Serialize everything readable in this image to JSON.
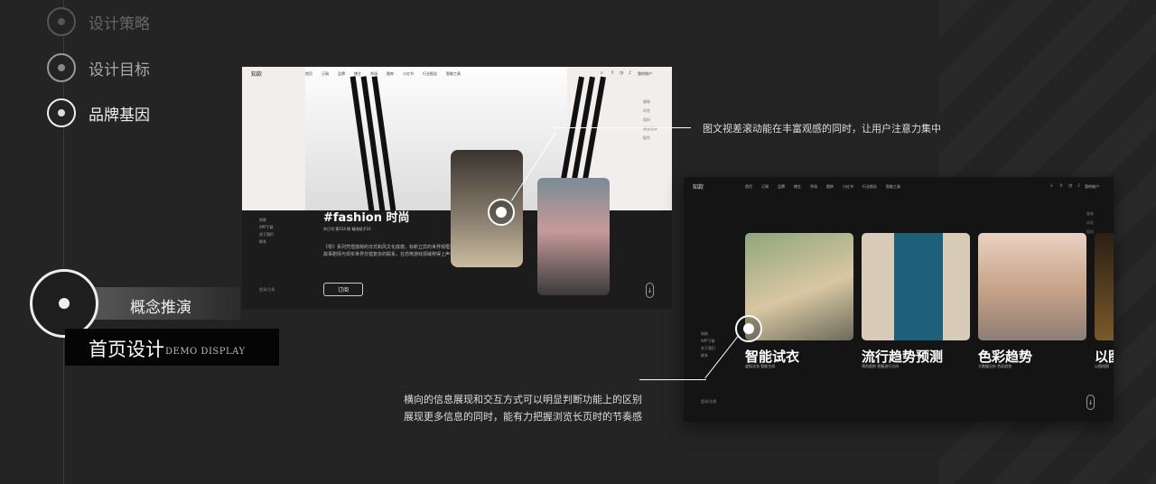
{
  "sidebar": {
    "items": [
      {
        "label": "设计策略"
      },
      {
        "label": "设计目标"
      },
      {
        "label": "品牌基因"
      }
    ],
    "concept_label": "概念推演",
    "section_title": "首页设计",
    "section_subtitle": "DEMO DISPLAY"
  },
  "annotations": {
    "first": "图文视差滚动能在丰富观感的同时，让用户注意力集中",
    "second_line1": "横向的信息展现和交互方式可以明显判断功能上的区别",
    "second_line2": "展现更多信息的同时，能有力把握浏览长页时的节奏感"
  },
  "mockup1": {
    "logo": "知款",
    "nav": [
      "首页",
      "订阅",
      "品牌",
      "博主",
      "秀场",
      "图库",
      "小红书",
      "行业报告",
      "智能工具"
    ],
    "search_label": "搜索",
    "account": "我的账户",
    "right_tags": [
      "服装",
      "印花",
      "面料",
      "视觉设计",
      "配色"
    ],
    "side_links": [
      "知款",
      "APP下载",
      "关于我们",
      "联系"
    ],
    "title": "#fashion 时尚",
    "meta": "外日刊 第154 期 精选帖子10",
    "description": "《零》系列凭借独特的日式和风文化底蕴，标新立异的世界观框架，以及故事剧情与现实世界交错复杂的联系，在恐怖游戏领域称得上声名远播。",
    "subscribe_label": "订阅",
    "login": "登录/注册"
  },
  "mockup2": {
    "logo": "知款",
    "nav": [
      "首页",
      "订阅",
      "品牌",
      "博主",
      "秀场",
      "图库",
      "小红书",
      "行业报告",
      "智能工具"
    ],
    "account": "我的账户",
    "right_tags": [
      "服装",
      "印花",
      "面料"
    ],
    "side_links": [
      "知款",
      "APP下载",
      "关于我们",
      "联系"
    ],
    "login": "登录/注册",
    "cards": [
      {
        "title": "智能试衣",
        "subtitle": "虚拟试衣 智能生成"
      },
      {
        "title": "流行趋势预测",
        "subtitle": "预判趋势 把握流行方向"
      },
      {
        "title": "色彩趋势",
        "subtitle": "大数据分析 色彩趋势"
      },
      {
        "title": "以图",
        "subtitle": "以图搜图"
      }
    ]
  }
}
